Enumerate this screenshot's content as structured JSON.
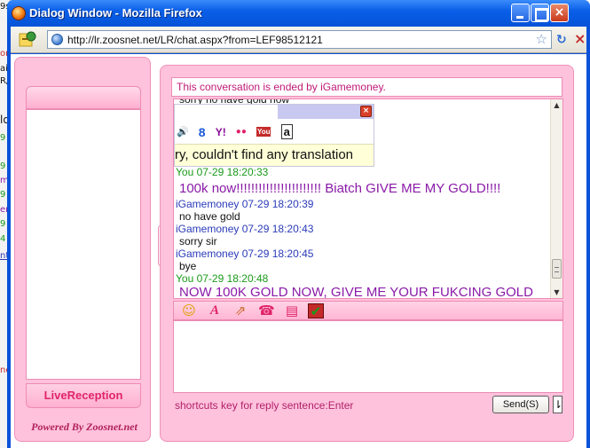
{
  "window": {
    "title": "Dialog Window - Mozilla Firefox",
    "close_glyph": "×"
  },
  "address_bar": {
    "url": "http://lr.zoosnet.net/LR/chat.aspx?from=LEF98512121",
    "star_glyph": "☆",
    "reload_glyph": "↻",
    "stop_glyph": "×"
  },
  "background_window": {
    "fragments": [
      "9s",
      "on",
      "ai",
      "R/",
      "ld",
      "9",
      "9",
      "m",
      "9",
      "en",
      "9",
      "4",
      "nt",
      "ne"
    ]
  },
  "left_panel": {
    "live_reception": "LiveReception",
    "powered_by": "Powered By Zoosnet.net",
    "collapse_glyph": "◂"
  },
  "chat": {
    "notice": "This conversation is ended by iGamemoney.",
    "partial_top_line": "sorry no have gold now",
    "messages": [
      {
        "sender": "You",
        "time": "07-29 18:20:33",
        "meta": "You 07-29 18:20:33",
        "text": "100k now!!!!!!!!!!!!!!!!!!!!!!! Biatch GIVE ME MY GOLD!!!!"
      },
      {
        "sender": "iGamemoney",
        "time": "07-29 18:20:39",
        "meta": "iGamemoney 07-29 18:20:39",
        "text": "no have gold"
      },
      {
        "sender": "iGamemoney",
        "time": "07-29 18:20:43",
        "meta": "iGamemoney 07-29 18:20:43",
        "text": "sorry sir"
      },
      {
        "sender": "iGamemoney",
        "time": "07-29 18:20:45",
        "meta": "iGamemoney 07-29 18:20:45",
        "text": "bye"
      },
      {
        "sender": "You",
        "time": "07-29 18:20:48",
        "meta": "You 07-29 18:20:48",
        "text": "NOW 100K GOLD NOW, GIVE ME YOUR FUKCING GOLD"
      }
    ],
    "scroll_up": "▲",
    "scroll_down": "▼"
  },
  "translation_popup": {
    "message": "ry, couldn't find any translation",
    "close_glyph": "×",
    "icons": [
      {
        "name": "speaker-icon",
        "glyph": "🔊",
        "color": "#2a6bd4"
      },
      {
        "name": "google-icon",
        "glyph": "8",
        "color": "#1a5ad8"
      },
      {
        "name": "yahoo-icon",
        "glyph": "Y!",
        "color": "#8a0a9a"
      },
      {
        "name": "flickr-icon",
        "glyph": "●●",
        "color": "#e0246a"
      },
      {
        "name": "youtube-icon",
        "glyph": "You",
        "color": "#c42a2a"
      },
      {
        "name": "amazon-icon",
        "glyph": "a",
        "color": "#111111"
      }
    ]
  },
  "toolbar": {
    "tools": [
      {
        "name": "emoticon-icon",
        "glyph": "☺",
        "color": "#e0a000"
      },
      {
        "name": "font-icon",
        "glyph": "A",
        "color": "#e0246a"
      },
      {
        "name": "screenshot-icon",
        "glyph": "⇗",
        "color": "#c86a2a"
      },
      {
        "name": "phone-icon",
        "glyph": "☎",
        "color": "#e0246a"
      },
      {
        "name": "clipboard-icon",
        "glyph": "▤",
        "color": "#e0246a"
      },
      {
        "name": "check-icon",
        "glyph": "✔",
        "color": "#1a9a1a"
      }
    ]
  },
  "footer": {
    "shortcuts": "shortcuts key for reply sentence:Enter",
    "send_label": "Send(S)",
    "send_arrow": "⇂"
  },
  "colors": {
    "accent_pink": "#ffc2dc",
    "border_pink": "#ec8bb4",
    "you_color": "#1a9a1a",
    "agent_color": "#2a3ab8",
    "big_text_color": "#8a1aa8"
  }
}
